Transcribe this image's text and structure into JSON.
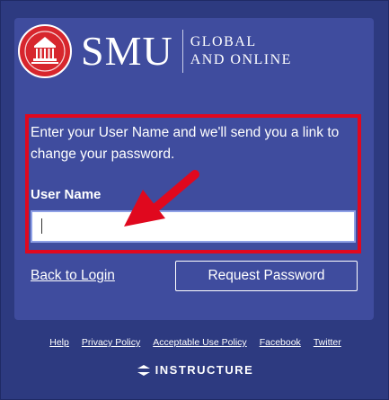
{
  "brand": {
    "name": "SMU",
    "tagline_line1": "Global",
    "tagline_line2": "and Online",
    "seal_color": "#d7262d"
  },
  "form": {
    "instructions": "Enter your User Name and we'll send you a link to change your password.",
    "username_label": "User Name",
    "username_value": "",
    "back_link": "Back to Login",
    "submit_label": "Request Password"
  },
  "footer": {
    "links": [
      "Help",
      "Privacy Policy",
      "Acceptable Use Policy",
      "Facebook",
      "Twitter"
    ],
    "powered_by": "INSTRUCTURE"
  },
  "colors": {
    "background": "#2d3a80",
    "card": "#3f4c9e",
    "highlight": "#e0081e"
  }
}
